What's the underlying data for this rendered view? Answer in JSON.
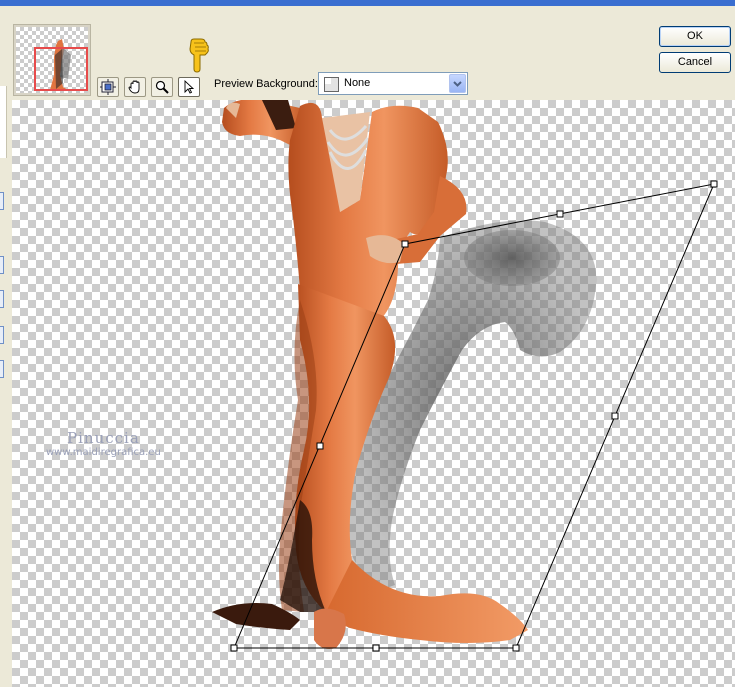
{
  "toolbar": {
    "tools": [
      {
        "name": "pan-zoom-tool",
        "icon": "pan-zoom-icon"
      },
      {
        "name": "hand-tool",
        "icon": "hand-icon"
      },
      {
        "name": "zoom-tool",
        "icon": "magnifier-icon"
      },
      {
        "name": "arrow-tool",
        "icon": "arrow-cursor-icon",
        "active": true
      }
    ],
    "pointer_icon": "pointing-hand-icon"
  },
  "preview_background": {
    "label": "Preview Background:",
    "selected": "None"
  },
  "buttons": {
    "ok": "OK",
    "cancel": "Cancel"
  },
  "watermark": {
    "line1": "Pinuccia",
    "line2": "www.maidiregrafica.eu"
  },
  "colors": {
    "accent_title": "#3a6ed0",
    "dress": "#e0743f",
    "thumbnail_viewport": "#e74b4b"
  }
}
